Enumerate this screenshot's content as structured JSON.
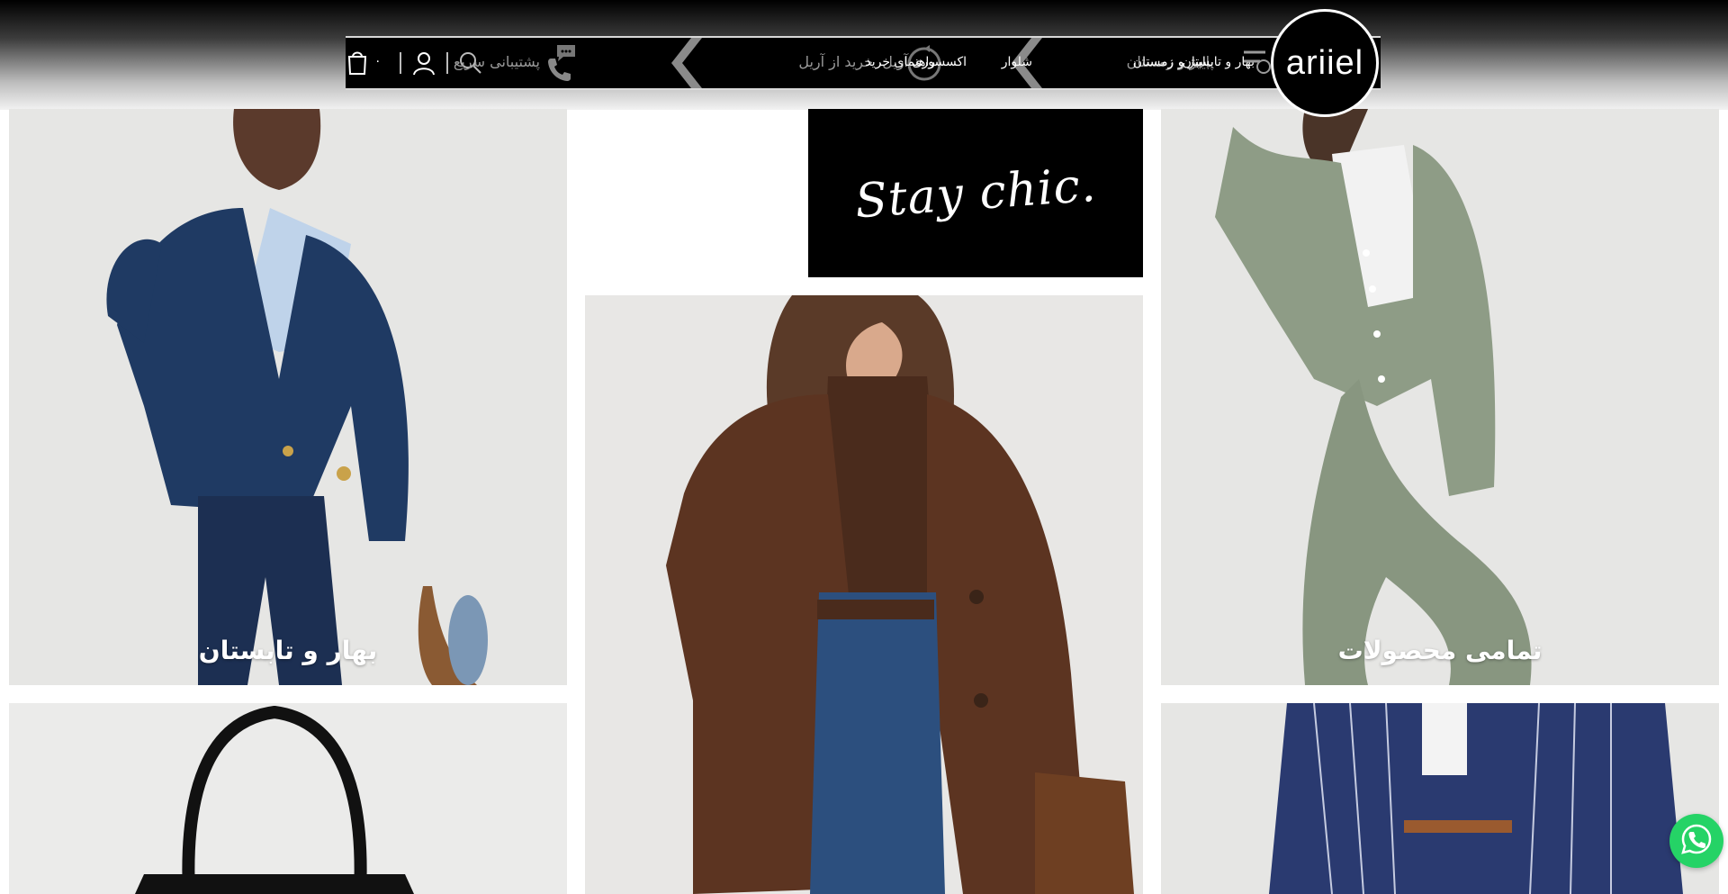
{
  "header": {
    "logo_text": "ariiel",
    "menu": [
      {
        "label": "بهار و تابستان"
      },
      {
        "label": "پاییز و زمستان"
      },
      {
        "label": "شلوار"
      },
      {
        "label": "اکسسوری"
      },
      {
        "label": "راهنمای خرید"
      }
    ],
    "ghost_text_1": "پاییز و زمستان",
    "ghost_text_2": "آریل، خرید از آریل",
    "support_label": "پشتیبانی سریع",
    "cart_count": "۰"
  },
  "promo": {
    "text": "Stay chic."
  },
  "tiles": [
    {
      "label": "بهار و تابستان"
    },
    {
      "label": "تمامی محصولات"
    }
  ],
  "colors": {
    "accent": "#000000",
    "whatsapp": "#25d366",
    "tile_bg": "#e6e6e4"
  },
  "icons": [
    "search-icon",
    "user-icon",
    "cart-icon",
    "phone-icon",
    "chat-icon",
    "refresh-icon",
    "menu-icon",
    "whatsapp-icon"
  ]
}
